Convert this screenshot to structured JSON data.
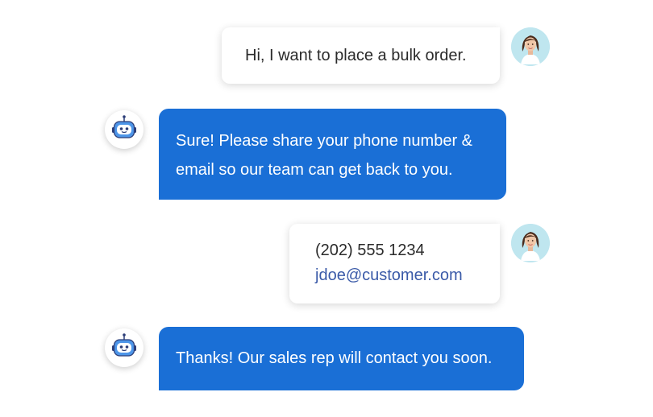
{
  "conversation": {
    "messages": [
      {
        "sender": "user",
        "text": "Hi, I want to place a bulk order."
      },
      {
        "sender": "bot",
        "lines": [
          "Sure! Please share your phone number &",
          "email so our team can get back to you."
        ]
      },
      {
        "sender": "user",
        "phone": "(202) 555 1234",
        "email": "jdoe@customer.com"
      },
      {
        "sender": "bot",
        "text": "Thanks! Our sales rep will contact you soon."
      }
    ]
  },
  "icons": {
    "user_avatar": "woman-avatar-icon",
    "bot_avatar": "robot-icon"
  },
  "colors": {
    "bot_bubble": "#1a6fd6",
    "user_bubble": "#ffffff",
    "email_link": "#3a5aa8"
  }
}
